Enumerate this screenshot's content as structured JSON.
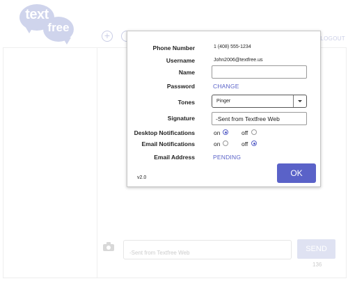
{
  "app": {
    "logo_text_top": "text",
    "logo_text_bottom": "free",
    "logout_label": "LOGOUT",
    "compose_placeholder": "-Sent from Textfree Web",
    "send_label": "SEND",
    "char_count": "136",
    "colors": {
      "accent": "#5a62c8",
      "logo": "#cfd4ec",
      "send_disabled": "#dfe2f2"
    }
  },
  "settings": {
    "phone_label": "Phone Number",
    "phone_value": "1 (408) 555-1234",
    "username_label": "Username",
    "username_value": "John2006@textfree.us",
    "name_label": "Name",
    "name_value": "",
    "password_label": "Password",
    "password_action": "CHANGE",
    "tones_label": "Tones",
    "tones_selected": "Pinger",
    "signature_label": "Signature",
    "signature_value": "-Sent from Textfree Web",
    "desktop_notif_label": "Desktop Notifications",
    "desktop_notif": {
      "on_label": "on",
      "off_label": "off",
      "selected": "on"
    },
    "email_notif_label": "Email Notifications",
    "email_notif": {
      "on_label": "on",
      "off_label": "off",
      "selected": "off"
    },
    "email_address_label": "Email Address",
    "email_address_status": "PENDING",
    "version": "v2.0",
    "ok_label": "OK"
  }
}
